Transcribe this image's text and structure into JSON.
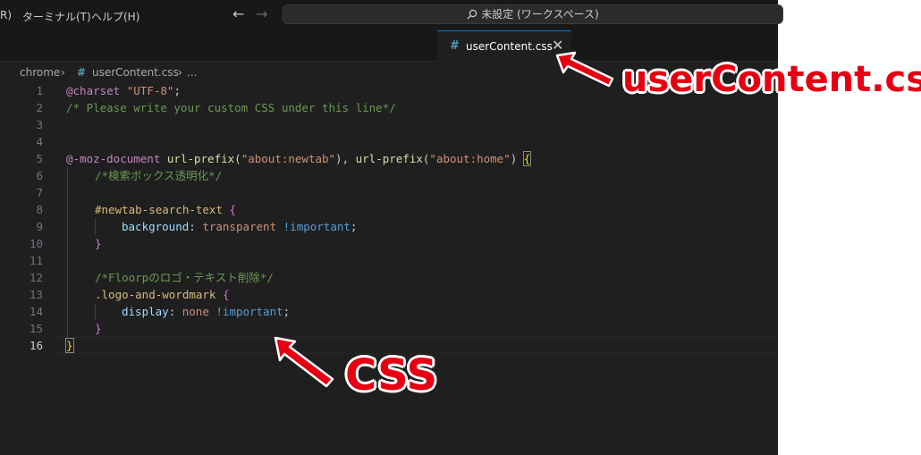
{
  "menu": {
    "item_partial": "R)",
    "terminal": "ターミナル(T)",
    "help": "ヘルプ(H)"
  },
  "nav": {
    "back": "←",
    "forward": "→"
  },
  "command_center": {
    "text": "未設定 (ワークスペース)",
    "icon": "search-icon"
  },
  "tab": {
    "icon": "#",
    "label": "userContent.css",
    "close": "✕"
  },
  "breadcrumb": {
    "folder": "chrome",
    "sep": "›",
    "file_icon": "#",
    "file": "userContent.css",
    "more": "..."
  },
  "code_lines": [
    {
      "n": "1",
      "active": false
    },
    {
      "n": "2",
      "active": false
    },
    {
      "n": "3",
      "active": false
    },
    {
      "n": "4",
      "active": false
    },
    {
      "n": "5",
      "active": false
    },
    {
      "n": "6",
      "active": false
    },
    {
      "n": "7",
      "active": false
    },
    {
      "n": "8",
      "active": false
    },
    {
      "n": "9",
      "active": false
    },
    {
      "n": "10",
      "active": false
    },
    {
      "n": "11",
      "active": false
    },
    {
      "n": "12",
      "active": false
    },
    {
      "n": "13",
      "active": false
    },
    {
      "n": "14",
      "active": false
    },
    {
      "n": "15",
      "active": false
    },
    {
      "n": "16",
      "active": true
    }
  ],
  "code": {
    "l1_at": "@charset",
    "l1_str": "\"UTF-8\"",
    "l1_end": ";",
    "l2": "/* Please write your custom CSS under this line*/",
    "l5_at": "@-moz-document",
    "l5_fn1": "url-prefix",
    "l5_p1": "(",
    "l5_s1": "\"about:newtab\"",
    "l5_c": "), ",
    "l5_fn2": "url-prefix",
    "l5_p2": "(",
    "l5_s2": "\"about:home\"",
    "l5_p3": ") ",
    "l5_br": "{",
    "l6": "/*検索ボックス透明化*/",
    "l8_sel": "#newtab-search-text",
    "l8_br": "{",
    "l9_prop": "background",
    "l9_colon": ": ",
    "l9_val": "transparent",
    "l9_imp": "!important",
    "l9_end": ";",
    "l10_br": "}",
    "l12": "/*Floorpのロゴ・テキスト削除*/",
    "l13_sel": ".logo-and-wordmark",
    "l13_br": "{",
    "l14_prop": "display",
    "l14_colon": ": ",
    "l14_val": "none",
    "l14_imp": "!important",
    "l14_end": ";",
    "l15_br": "}",
    "l16_br": "}"
  },
  "annotations": {
    "filename": "userContent.css",
    "css": "CSS",
    "color": "#e60012"
  }
}
